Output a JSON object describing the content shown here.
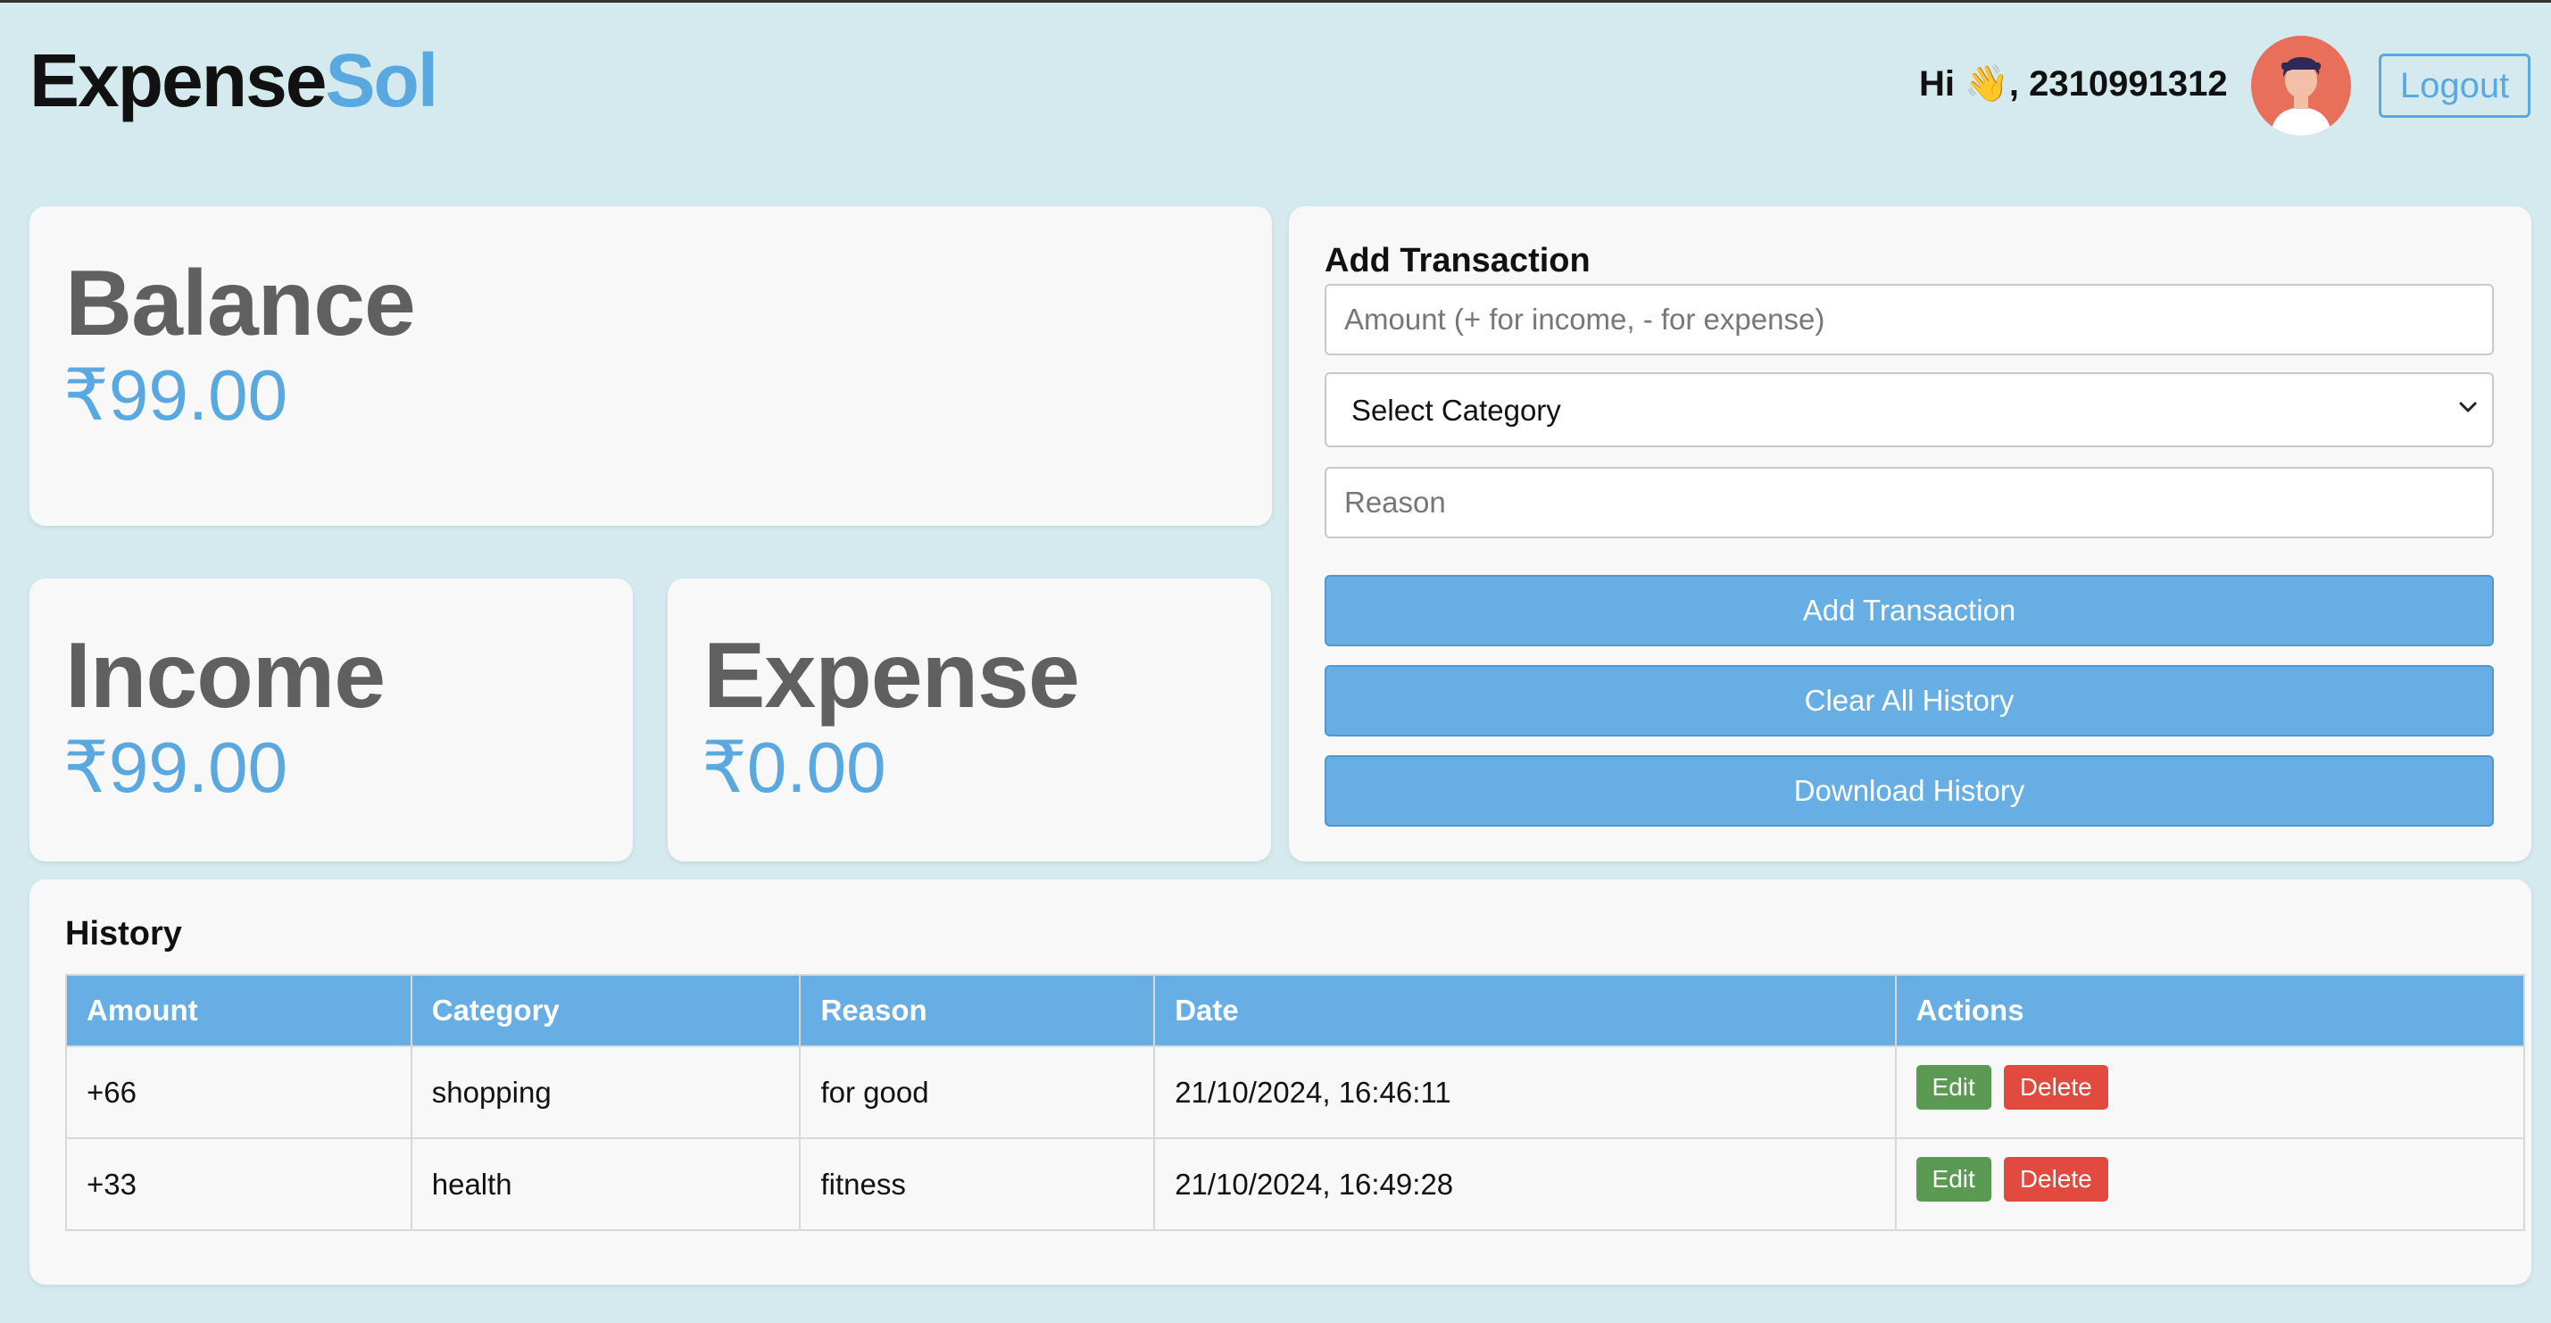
{
  "header": {
    "logo_primary": "Expense",
    "logo_accent": "Sol",
    "greeting": "Hi 👋, 2310991312",
    "logout_label": "Logout"
  },
  "balance": {
    "label": "Balance",
    "value": "₹99.00"
  },
  "income": {
    "label": "Income",
    "value": "₹99.00"
  },
  "expense": {
    "label": "Expense",
    "value": "₹0.00"
  },
  "add_transaction": {
    "title": "Add Transaction",
    "amount_placeholder": "Amount (+ for income, - for expense)",
    "category_selected": "Select Category",
    "reason_placeholder": "Reason",
    "add_button": "Add Transaction",
    "clear_button": "Clear All History",
    "download_button": "Download History"
  },
  "history": {
    "title": "History",
    "columns": [
      "Amount",
      "Category",
      "Reason",
      "Date",
      "Actions"
    ],
    "rows": [
      {
        "amount": "+66",
        "category": "shopping",
        "reason": "for good",
        "date": "21/10/2024, 16:46:11",
        "edit": "Edit",
        "delete": "Delete"
      },
      {
        "amount": "+33",
        "category": "health",
        "reason": "fitness",
        "date": "21/10/2024, 16:49:28",
        "edit": "Edit",
        "delete": "Delete"
      }
    ]
  },
  "colors": {
    "accent": "#5aa8e0",
    "button": "#66aee4",
    "edit": "#5a9a52",
    "delete": "#e14b3f",
    "background": "#d4eaef"
  }
}
